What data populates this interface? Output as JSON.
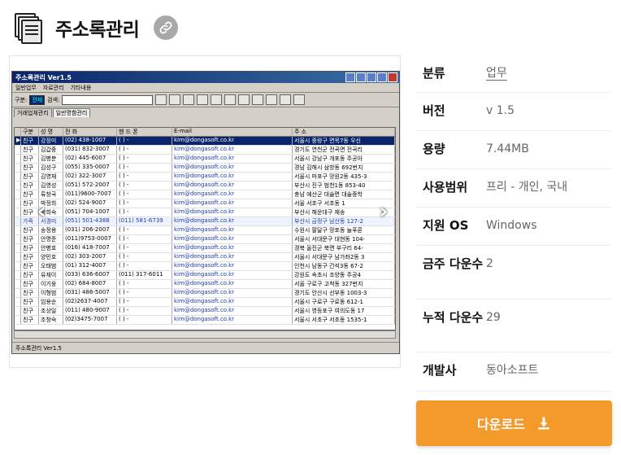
{
  "header": {
    "title": "주소록관리"
  },
  "screenshot": {
    "window_title": "주소록관리 Ver1.5",
    "menu": [
      "일반업무",
      "자료관리",
      "기타내용"
    ],
    "toolbar": {
      "group_label": "구분:",
      "group_value": "전체",
      "search_label": "검색:"
    },
    "tabs": [
      "거래업체관리",
      "일반명함관리"
    ],
    "columns": [
      "구분",
      "성  명",
      "전  화",
      "핸 드 폰",
      "E-mail",
      "주         소"
    ],
    "rows": [
      [
        "친구",
        "강정미",
        "(02) 438-1007",
        "( ) -",
        "kim@dongasoft.co.kr",
        "서울시 중랑구 면목7동 우신"
      ],
      [
        "친구",
        "김갑중",
        "(031) 832-3007",
        "( ) -",
        "kim@dongasoft.co.kr",
        "경기도 연천군 전곡면 전곡리"
      ],
      [
        "친구",
        "김병분",
        "(02) 445-6007",
        "( ) -",
        "kim@dongasoft.co.kr",
        "서울시 강남구 개포동 주공아"
      ],
      [
        "친구",
        "김성구",
        "(055) 335-0007",
        "( ) -",
        "kim@dongasoft.co.kr",
        "경남 김해시 삼방동 692번지"
      ],
      [
        "친구",
        "김영재",
        "(02) 322-3007",
        "( ) -",
        "kim@dongasoft.co.kr",
        "서울시 마포구 망원2동 435-3"
      ],
      [
        "친구",
        "김영성",
        "(051) 572-2007",
        "( ) -",
        "kim@dongasoft.co.kr",
        "부산시 진구 범천1동 853-40"
      ],
      [
        "친구",
        "류창국",
        "(011)9600-7007",
        "( ) -",
        "kim@dongasoft.co.kr",
        "충남 예산군 대술면 대술중학"
      ],
      [
        "친구",
        "박정희",
        "(02) 524-9007",
        "( ) -",
        "kim@dongasoft.co.kr",
        "서울 서초구 서초동 1"
      ],
      [
        "친구",
        "박희숙",
        "(051) 704-1007",
        "( ) -",
        "kim@dongasoft.co.kr",
        "부산시 해운대구 재송"
      ],
      [
        "가족",
        "서경미",
        "(051) 501-4388",
        "(011) 581-6739",
        "kim@dongasoft.co.kr",
        "부산시 금정구 남산동 127-2"
      ],
      [
        "친구",
        "송정용",
        "(031) 206-2007",
        "( ) -",
        "kim@dongasoft.co.kr",
        "수원시 팔달구 망포동 늘푸른"
      ],
      [
        "친구",
        "안명준",
        "(011)9753-0007",
        "( ) -",
        "kim@dongasoft.co.kr",
        "서울시 서대문구 대현동 104-"
      ],
      [
        "친구",
        "안병호",
        "(016) 418-7007",
        "( ) -",
        "kim@dongasoft.co.kr",
        "경북 울진군 북면 부구리 64-"
      ],
      [
        "친구",
        "양민호",
        "(02) 303-2007",
        "( ) -",
        "kim@dongasoft.co.kr",
        "서울시 서대문구 남가좌2동 3"
      ],
      [
        "친구",
        "오태범",
        "(01) 312-4007",
        "( ) -",
        "kim@dongasoft.co.kr",
        "인천시 남동구 간석3동 67-2"
      ],
      [
        "친구",
        "유재이",
        "(033) 636-6007",
        "(011) 317-6011",
        "kim@dongasoft.co.kr",
        "강원도 속초시 조양동 주공4"
      ],
      [
        "친구",
        "이기웅",
        "(02) 684-8007",
        "( ) -",
        "kim@dongasoft.co.kr",
        "서울 구로구 고척동 327번지"
      ],
      [
        "친구",
        "이형범",
        "(031) 486-5007",
        "( ) -",
        "kim@dongasoft.co.kr",
        "경기도 안산시 선부동 1003-3"
      ],
      [
        "친구",
        "임용순",
        "(02)2637-4007",
        "( ) -",
        "kim@dongasoft.co.kr",
        "서울시 구로구 구로동 612-1"
      ],
      [
        "친구",
        "조상일",
        "(011) 480-9007",
        "( ) -",
        "kim@dongasoft.co.kr",
        "서울시 영등포구 여의도동 17"
      ],
      [
        "친구",
        "조창숙",
        "(02)3475-7007",
        "( ) -",
        "kim@dongasoft.co.kr",
        "서울시 서초구 서초동 1535-1"
      ]
    ],
    "status": "주소록관리 Ver1.5"
  },
  "info": [
    {
      "key": "분류",
      "value": "업무",
      "link": true
    },
    {
      "key": "버전",
      "value": "v 1.5"
    },
    {
      "key": "용량",
      "value": "7.44MB"
    },
    {
      "key": "사용범위",
      "value": "프리 - 개인, 국내"
    },
    {
      "key": "지원 OS",
      "value": "Windows"
    },
    {
      "key": "금주 다운수",
      "value": "2"
    },
    {
      "key": "누적 다운수",
      "value": "29"
    },
    {
      "key": "개발사",
      "value": "동아소프트"
    }
  ],
  "download": {
    "label": "다운로드"
  },
  "icons": {
    "link": "link-icon",
    "download": "download-icon",
    "prev": "chevron-left-icon",
    "next": "chevron-right-icon"
  },
  "colors": {
    "accent": "#f39a2b",
    "link_btn": "#a8a8a8"
  }
}
